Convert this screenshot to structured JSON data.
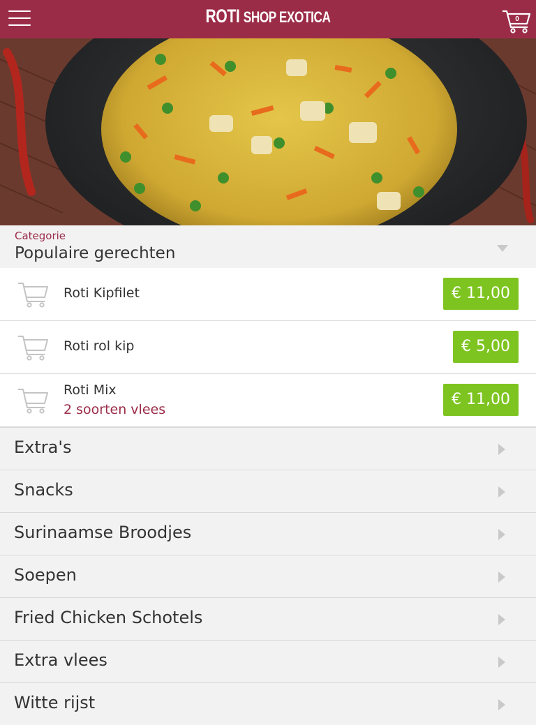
{
  "header": {
    "brand_main": "ROTI",
    "brand_sub": "SHOP EXOTICA",
    "cart_count": "0"
  },
  "category": {
    "label": "Categorie",
    "value": "Populaire gerechten"
  },
  "items": [
    {
      "name": "Roti Kipfilet",
      "subtitle": "",
      "price": "€ 11,00"
    },
    {
      "name": "Roti rol kip",
      "subtitle": "",
      "price": "€ 5,00"
    },
    {
      "name": "Roti Mix",
      "subtitle": "2 soorten vlees",
      "price": "€ 11,00"
    }
  ],
  "categories": [
    "Extra's",
    "Snacks",
    "Surinaamse Broodjes",
    "Soepen",
    "Fried Chicken Schotels",
    "Extra vlees",
    "Witte rijst"
  ],
  "colors": {
    "brand": "#9b2c48",
    "price": "#7ec420",
    "background": "#f2f2f2"
  },
  "icons": [
    "hamburger-menu-icon",
    "shopping-cart-icon",
    "chevron-down-icon",
    "chevron-right-icon"
  ]
}
